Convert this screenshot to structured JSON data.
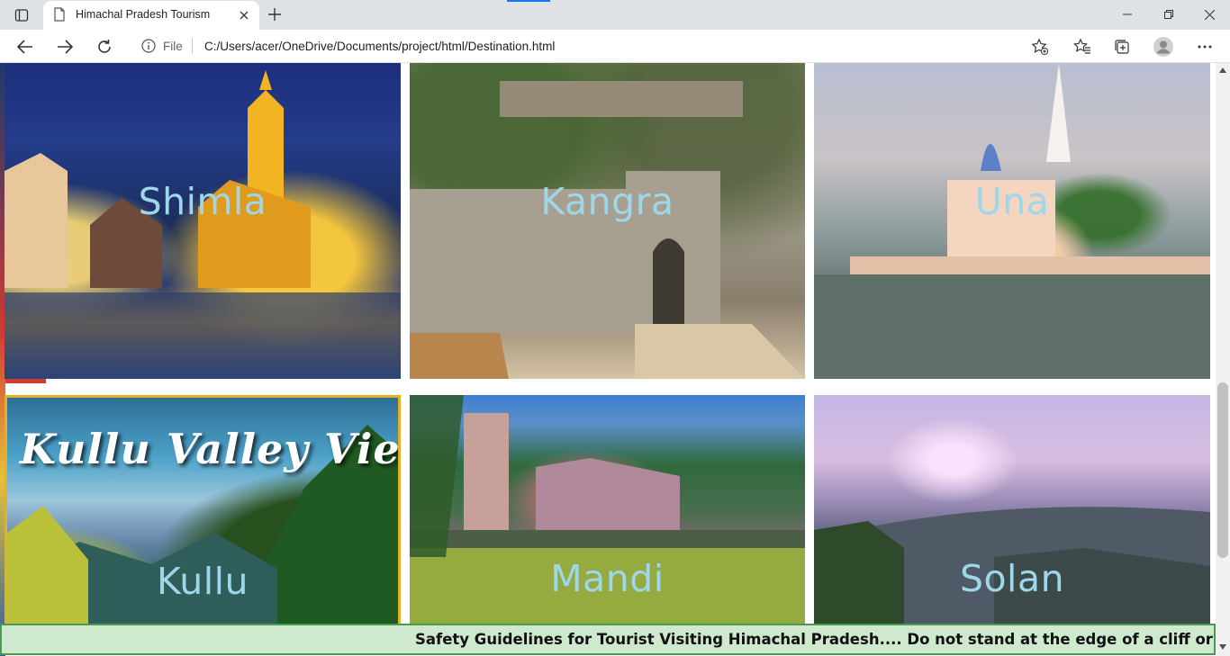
{
  "browser": {
    "tab": {
      "title": "Himachal Pradesh Tourism"
    },
    "address_bar": {
      "scheme_label": "File",
      "url": "C:/Users/acer/OneDrive/Documents/project/html/Destination.html"
    }
  },
  "destinations": [
    {
      "name": "Shimla"
    },
    {
      "name": "Kangra"
    },
    {
      "name": "Una"
    },
    {
      "name": "Kullu",
      "banner_text": "Kullu Valley View"
    },
    {
      "name": "Mandi"
    },
    {
      "name": "Solan"
    }
  ],
  "marquee": {
    "text": "Safety Guidelines for Tourist Visiting Himachal Pradesh.... Do not stand at the edge of a cliff or on"
  },
  "colors": {
    "label_text": "#9fd7ea",
    "marquee_bg": "#cfe9cf",
    "marquee_border": "#4a9a52",
    "kullu_frame": "#e5b023"
  }
}
